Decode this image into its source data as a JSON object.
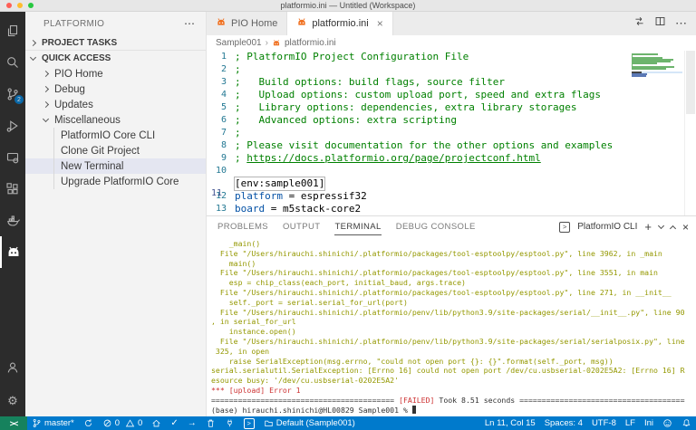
{
  "colors": {
    "accent": "#007acc",
    "remote_green": "#16825d",
    "terminal_yellow": "#949800",
    "terminal_red": "#cd3131",
    "comment_green": "#008000",
    "key_blue": "#0451a5"
  },
  "window": {
    "title": "platformio.ini — Untitled (Workspace)"
  },
  "activity_bar": {
    "badge": "2",
    "items": [
      "explorer",
      "search",
      "source-control",
      "run-and-debug",
      "remote-explorer",
      "extensions",
      "docker",
      "platformio",
      "accounts",
      "settings"
    ]
  },
  "icons": {
    "more": "⋯",
    "gear": "⚙",
    "check": "✓",
    "arrow": "→",
    "crumb_sep": "›",
    "shell_prompt": ">"
  },
  "sidebar": {
    "title": "PLATFORMIO",
    "rows": [
      {
        "label": "PROJECT TASKS",
        "section": true,
        "chevron": "r",
        "divider": true
      },
      {
        "label": "QUICK ACCESS",
        "section": true,
        "chevron": "d"
      },
      {
        "label": "PIO Home",
        "indent": 1,
        "chevron": "r"
      },
      {
        "label": "Debug",
        "indent": 1,
        "chevron": "r"
      },
      {
        "label": "Updates",
        "indent": 1,
        "chevron": "r"
      },
      {
        "label": "Miscellaneous",
        "indent": 1,
        "chevron": "d"
      },
      {
        "label": "PlatformIO Core CLI",
        "indent": 2,
        "guide": true
      },
      {
        "label": "Clone Git Project",
        "indent": 2,
        "guide": true
      },
      {
        "label": "New Terminal",
        "indent": 2,
        "guide": true,
        "selected": true
      },
      {
        "label": "Upgrade PlatformIO Core",
        "indent": 2,
        "guide": true
      }
    ]
  },
  "editor": {
    "tabs": [
      {
        "label": "PIO Home",
        "active": false
      },
      {
        "label": "platformio.ini",
        "active": true,
        "close": "×"
      }
    ],
    "breadcrumb": {
      "project": "Sample001",
      "file": "platformio.ini"
    }
  },
  "code": {
    "lines": [
      {
        "n": "1",
        "segs": [
          {
            "c": "comment",
            "t": "; PlatformIO Project Configuration File"
          }
        ]
      },
      {
        "n": "2",
        "segs": [
          {
            "c": "comment",
            "t": ";"
          }
        ]
      },
      {
        "n": "3",
        "segs": [
          {
            "c": "comment",
            "t": ";   Build options: build flags, source filter"
          }
        ]
      },
      {
        "n": "4",
        "segs": [
          {
            "c": "comment",
            "t": ";   Upload options: custom upload port, speed and extra flags"
          }
        ]
      },
      {
        "n": "5",
        "segs": [
          {
            "c": "comment",
            "t": ";   Library options: dependencies, extra library storages"
          }
        ]
      },
      {
        "n": "6",
        "segs": [
          {
            "c": "comment",
            "t": ";   Advanced options: extra scripting"
          }
        ]
      },
      {
        "n": "7",
        "segs": [
          {
            "c": "comment",
            "t": ";"
          }
        ]
      },
      {
        "n": "8",
        "segs": [
          {
            "c": "comment",
            "t": "; Please visit documentation for the other options and examples"
          }
        ]
      },
      {
        "n": "9",
        "segs": [
          {
            "c": "comment",
            "t": "; "
          },
          {
            "c": "link",
            "t": "https://docs.platformio.org/page/projectconf.html"
          }
        ]
      },
      {
        "n": "10",
        "segs": []
      },
      {
        "n": "11",
        "current": true,
        "segs": [
          {
            "c": "section",
            "t": "[env:sample001]"
          }
        ]
      },
      {
        "n": "12",
        "segs": [
          {
            "c": "key",
            "t": "platform"
          },
          {
            "c": "plain",
            "t": " = espressif32"
          }
        ]
      },
      {
        "n": "13",
        "segs": [
          {
            "c": "key",
            "t": "board"
          },
          {
            "c": "plain",
            "t": " = m5stack-core2"
          }
        ]
      }
    ]
  },
  "panel": {
    "tabs": [
      {
        "label": "PROBLEMS",
        "active": false
      },
      {
        "label": "OUTPUT",
        "active": false
      },
      {
        "label": "TERMINAL",
        "active": true
      },
      {
        "label": "DEBUG CONSOLE",
        "active": false
      }
    ],
    "shell_label": "PlatformIO CLI",
    "new_terminal": "+",
    "close": "×"
  },
  "terminal": {
    "lines": [
      [
        {
          "c": "y",
          "t": "    _main()"
        }
      ],
      [
        {
          "c": "y",
          "t": "  File \"/Users/hirauchi.shinichi/.platformio/packages/tool-esptoolpy/esptool.py\", line 3962, in _main"
        }
      ],
      [
        {
          "c": "y",
          "t": "    main()"
        }
      ],
      [
        {
          "c": "y",
          "t": "  File \"/Users/hirauchi.shinichi/.platformio/packages/tool-esptoolpy/esptool.py\", line 3551, in main"
        }
      ],
      [
        {
          "c": "y",
          "t": "    esp = chip_class(each_port, initial_baud, args.trace)"
        }
      ],
      [
        {
          "c": "y",
          "t": "  File \"/Users/hirauchi.shinichi/.platformio/packages/tool-esptoolpy/esptool.py\", line 271, in __init__"
        }
      ],
      [
        {
          "c": "y",
          "t": "    self._port = serial.serial_for_url(port)"
        }
      ],
      [
        {
          "c": "y",
          "t": "  File \"/Users/hirauchi.shinichi/.platformio/penv/lib/python3.9/site-packages/serial/__init__.py\", line 90"
        }
      ],
      [
        {
          "c": "y",
          "t": ", in serial_for_url"
        }
      ],
      [
        {
          "c": "y",
          "t": "    instance.open()"
        }
      ],
      [
        {
          "c": "y",
          "t": "  File \"/Users/hirauchi.shinichi/.platformio/penv/lib/python3.9/site-packages/serial/serialposix.py\", line"
        }
      ],
      [
        {
          "c": "y",
          "t": " 325, in open"
        }
      ],
      [
        {
          "c": "y",
          "t": "    raise SerialException(msg.errno, \"could not open port {}: {}\".format(self._port, msg))"
        }
      ],
      [
        {
          "c": "y",
          "t": "serial.serialutil.SerialException: [Errno 16] could not open port /dev/cu.usbserial-0202E5A2: [Errno 16] R"
        }
      ],
      [
        {
          "c": "y",
          "t": "esource busy: '/dev/cu.usbserial-0202E5A2'"
        }
      ],
      [
        {
          "c": "r",
          "t": "*** [upload] Error 1"
        }
      ],
      [
        {
          "c": "k",
          "t": "========================================= "
        },
        {
          "c": "r",
          "t": "[FAILED]"
        },
        {
          "c": "k",
          "t": " Took 8.51 seconds ====================================="
        }
      ],
      [
        {
          "c": "k",
          "t": "(base) hirauchi.shinichi@HL00829 Sample001 % "
        },
        {
          "c": "cursor",
          "t": ""
        }
      ]
    ]
  },
  "status_bar": {
    "remote": "><",
    "branch": "master*",
    "errors": "0",
    "warnings": "0",
    "env": "Default (Sample001)",
    "line_col": "Ln 11, Col 15",
    "spaces": "Spaces: 4",
    "encoding": "UTF-8",
    "eol": "LF",
    "lang": "Ini"
  }
}
